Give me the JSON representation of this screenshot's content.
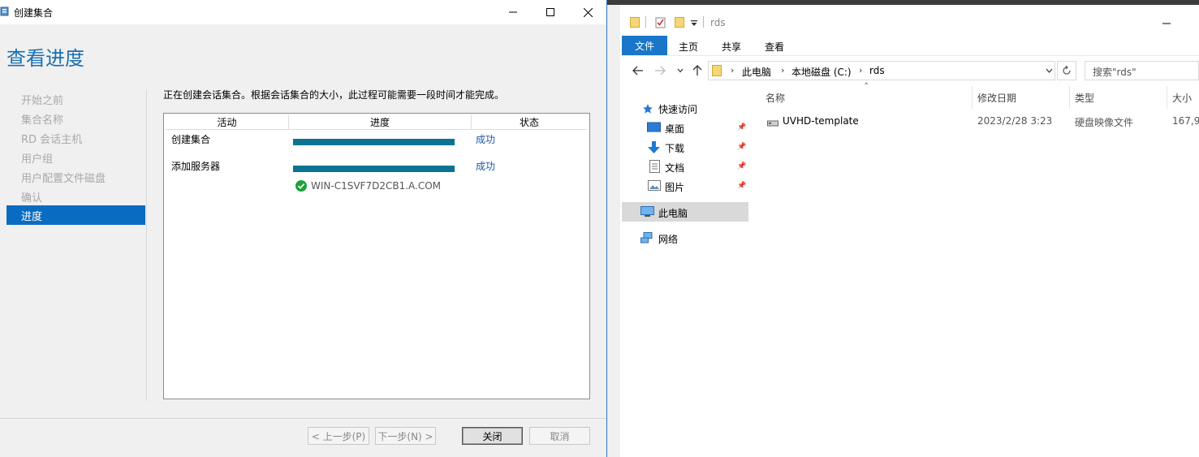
{
  "wizard": {
    "title": "创建集合",
    "heading": "查看进度",
    "nav": [
      {
        "label": "开始之前"
      },
      {
        "label": "集合名称"
      },
      {
        "label": "RD 会话主机"
      },
      {
        "label": "用户组"
      },
      {
        "label": "用户配置文件磁盘"
      },
      {
        "label": "确认"
      },
      {
        "label": "进度"
      }
    ],
    "description": "正在创建会话集合。根据会话集合的大小，此过程可能需要一段时间才能完成。",
    "table": {
      "headers": [
        "活动",
        "进度",
        "状态"
      ],
      "rows": [
        {
          "activity": "创建集合",
          "progress": 1.0,
          "status": "成功"
        },
        {
          "activity": "添加服务器",
          "progress": 1.0,
          "status": "成功",
          "server": "WIN-C1SVF7D2CB1.A.COM"
        }
      ]
    },
    "buttons": {
      "prev": "< 上一步(P)",
      "next": "下一步(N) >",
      "close": "关闭",
      "cancel": "取消"
    },
    "colors": {
      "accent": "#0a6cc1",
      "heading": "#1a6fb0",
      "bar": "#0a7492",
      "success": "#1d56a8"
    }
  },
  "explorer": {
    "title": "rds",
    "ribbon_tabs": [
      "文件",
      "主页",
      "共享",
      "查看"
    ],
    "breadcrumb": [
      "此电脑",
      "本地磁盘 (C:)",
      "rds"
    ],
    "search_placeholder": "搜索\"rds\"",
    "nav": {
      "quick_access": "快速访问",
      "pinned": [
        "桌面",
        "下载",
        "文档",
        "图片"
      ],
      "this_pc": "此电脑",
      "network": "网络"
    },
    "columns": [
      "名称",
      "修改日期",
      "类型",
      "大小"
    ],
    "files": [
      {
        "name": "UVHD-template",
        "modified": "2023/2/28 3:23",
        "type": "硬盘映像文件",
        "size": "167,9"
      }
    ]
  }
}
